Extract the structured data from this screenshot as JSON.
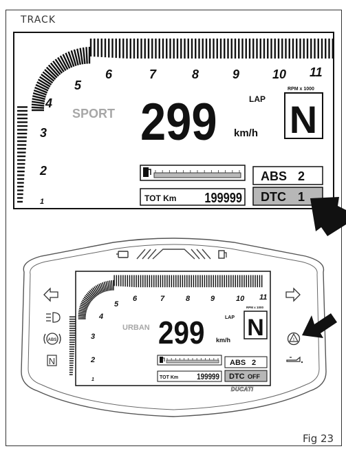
{
  "header": {
    "section_label": "TRACK"
  },
  "figure_label": "Fig 23",
  "display_large": {
    "mode": "SPORT",
    "speed": "299",
    "speed_unit": "km/h",
    "lap_label": "LAP",
    "gear": "N",
    "rpm_unit": "RPM x 1000",
    "rpm_scale": [
      "1",
      "2",
      "3",
      "4",
      "5",
      "6",
      "7",
      "8",
      "9",
      "10",
      "11"
    ],
    "odometer_label": "TOT Km",
    "odometer_value": "199999",
    "abs_label": "ABS",
    "abs_value": "2",
    "dtc_label": "DTC",
    "dtc_value": "1"
  },
  "display_small": {
    "mode": "URBAN",
    "speed": "299",
    "speed_unit": "km/h",
    "lap_label": "LAP",
    "gear": "N",
    "rpm_unit": "RPM x 1000",
    "rpm_scale": [
      "1",
      "2",
      "3",
      "4",
      "5",
      "6",
      "7",
      "8",
      "9",
      "10",
      "11"
    ],
    "odometer_label": "TOT Km",
    "odometer_value": "199999",
    "abs_label": "ABS",
    "abs_value": "2",
    "dtc_label": "DTC",
    "dtc_value": "OFF",
    "brand": "DUCATI"
  },
  "warning_lights": {
    "left": [
      "left-turn-icon",
      "high-beam-icon",
      "abs-warning-icon",
      "neutral-icon"
    ],
    "right": [
      "right-turn-icon",
      "hazard-warning-icon",
      "oil-pressure-icon"
    ],
    "top": [
      "engine-check-icon",
      "fuel-reserve-icon"
    ]
  }
}
